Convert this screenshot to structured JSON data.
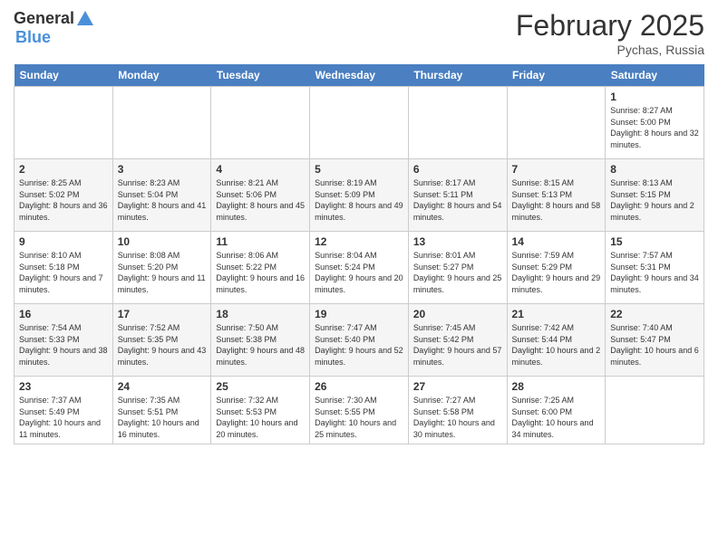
{
  "header": {
    "logo_general": "General",
    "logo_blue": "Blue",
    "month_title": "February 2025",
    "location": "Pychas, Russia"
  },
  "days_of_week": [
    "Sunday",
    "Monday",
    "Tuesday",
    "Wednesday",
    "Thursday",
    "Friday",
    "Saturday"
  ],
  "weeks": [
    [
      {
        "day": "",
        "info": ""
      },
      {
        "day": "",
        "info": ""
      },
      {
        "day": "",
        "info": ""
      },
      {
        "day": "",
        "info": ""
      },
      {
        "day": "",
        "info": ""
      },
      {
        "day": "",
        "info": ""
      },
      {
        "day": "1",
        "info": "Sunrise: 8:27 AM\nSunset: 5:00 PM\nDaylight: 8 hours and 32 minutes."
      }
    ],
    [
      {
        "day": "2",
        "info": "Sunrise: 8:25 AM\nSunset: 5:02 PM\nDaylight: 8 hours and 36 minutes."
      },
      {
        "day": "3",
        "info": "Sunrise: 8:23 AM\nSunset: 5:04 PM\nDaylight: 8 hours and 41 minutes."
      },
      {
        "day": "4",
        "info": "Sunrise: 8:21 AM\nSunset: 5:06 PM\nDaylight: 8 hours and 45 minutes."
      },
      {
        "day": "5",
        "info": "Sunrise: 8:19 AM\nSunset: 5:09 PM\nDaylight: 8 hours and 49 minutes."
      },
      {
        "day": "6",
        "info": "Sunrise: 8:17 AM\nSunset: 5:11 PM\nDaylight: 8 hours and 54 minutes."
      },
      {
        "day": "7",
        "info": "Sunrise: 8:15 AM\nSunset: 5:13 PM\nDaylight: 8 hours and 58 minutes."
      },
      {
        "day": "8",
        "info": "Sunrise: 8:13 AM\nSunset: 5:15 PM\nDaylight: 9 hours and 2 minutes."
      }
    ],
    [
      {
        "day": "9",
        "info": "Sunrise: 8:10 AM\nSunset: 5:18 PM\nDaylight: 9 hours and 7 minutes."
      },
      {
        "day": "10",
        "info": "Sunrise: 8:08 AM\nSunset: 5:20 PM\nDaylight: 9 hours and 11 minutes."
      },
      {
        "day": "11",
        "info": "Sunrise: 8:06 AM\nSunset: 5:22 PM\nDaylight: 9 hours and 16 minutes."
      },
      {
        "day": "12",
        "info": "Sunrise: 8:04 AM\nSunset: 5:24 PM\nDaylight: 9 hours and 20 minutes."
      },
      {
        "day": "13",
        "info": "Sunrise: 8:01 AM\nSunset: 5:27 PM\nDaylight: 9 hours and 25 minutes."
      },
      {
        "day": "14",
        "info": "Sunrise: 7:59 AM\nSunset: 5:29 PM\nDaylight: 9 hours and 29 minutes."
      },
      {
        "day": "15",
        "info": "Sunrise: 7:57 AM\nSunset: 5:31 PM\nDaylight: 9 hours and 34 minutes."
      }
    ],
    [
      {
        "day": "16",
        "info": "Sunrise: 7:54 AM\nSunset: 5:33 PM\nDaylight: 9 hours and 38 minutes."
      },
      {
        "day": "17",
        "info": "Sunrise: 7:52 AM\nSunset: 5:35 PM\nDaylight: 9 hours and 43 minutes."
      },
      {
        "day": "18",
        "info": "Sunrise: 7:50 AM\nSunset: 5:38 PM\nDaylight: 9 hours and 48 minutes."
      },
      {
        "day": "19",
        "info": "Sunrise: 7:47 AM\nSunset: 5:40 PM\nDaylight: 9 hours and 52 minutes."
      },
      {
        "day": "20",
        "info": "Sunrise: 7:45 AM\nSunset: 5:42 PM\nDaylight: 9 hours and 57 minutes."
      },
      {
        "day": "21",
        "info": "Sunrise: 7:42 AM\nSunset: 5:44 PM\nDaylight: 10 hours and 2 minutes."
      },
      {
        "day": "22",
        "info": "Sunrise: 7:40 AM\nSunset: 5:47 PM\nDaylight: 10 hours and 6 minutes."
      }
    ],
    [
      {
        "day": "23",
        "info": "Sunrise: 7:37 AM\nSunset: 5:49 PM\nDaylight: 10 hours and 11 minutes."
      },
      {
        "day": "24",
        "info": "Sunrise: 7:35 AM\nSunset: 5:51 PM\nDaylight: 10 hours and 16 minutes."
      },
      {
        "day": "25",
        "info": "Sunrise: 7:32 AM\nSunset: 5:53 PM\nDaylight: 10 hours and 20 minutes."
      },
      {
        "day": "26",
        "info": "Sunrise: 7:30 AM\nSunset: 5:55 PM\nDaylight: 10 hours and 25 minutes."
      },
      {
        "day": "27",
        "info": "Sunrise: 7:27 AM\nSunset: 5:58 PM\nDaylight: 10 hours and 30 minutes."
      },
      {
        "day": "28",
        "info": "Sunrise: 7:25 AM\nSunset: 6:00 PM\nDaylight: 10 hours and 34 minutes."
      },
      {
        "day": "",
        "info": ""
      }
    ]
  ]
}
